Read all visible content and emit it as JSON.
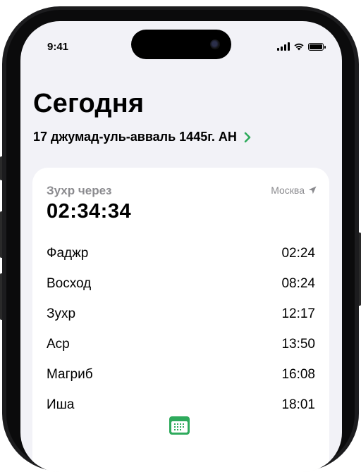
{
  "status_bar": {
    "time": "9:41"
  },
  "header": {
    "title": "Сегодня",
    "hijri_date": "17 джумад-уль-авваль 1445г. АН"
  },
  "card": {
    "next_prayer_label": "Зухр через",
    "countdown": "02:34:34",
    "location": "Москва",
    "prayers": [
      {
        "name": "Фаджр",
        "time": "02:24"
      },
      {
        "name": "Восход",
        "time": "08:24"
      },
      {
        "name": "Зухр",
        "time": "12:17"
      },
      {
        "name": "Аср",
        "time": "13:50"
      },
      {
        "name": "Магриб",
        "time": "16:08"
      },
      {
        "name": "Иша",
        "time": "18:01"
      }
    ]
  },
  "colors": {
    "accent_green": "#2eaa5c",
    "secondary_text": "#8a8a8e",
    "background": "#f2f2f7"
  },
  "icons": [
    "signal-icon",
    "wifi-icon",
    "battery-icon",
    "chevron-right-icon",
    "location-arrow-icon",
    "calendar-icon"
  ]
}
